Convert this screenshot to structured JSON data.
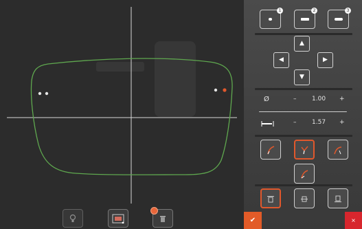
{
  "shape_tools": [
    {
      "name": "round-drill",
      "badge": "1"
    },
    {
      "name": "slot-drill",
      "badge": "2"
    },
    {
      "name": "notch-drill",
      "badge": "3"
    }
  ],
  "nudge": {
    "up": "▲",
    "left": "◀",
    "right": "▶",
    "down": "▼"
  },
  "diameter": {
    "symbol": "Ø",
    "minus": "–",
    "value": "1.00",
    "plus": "+"
  },
  "length": {
    "minus": "–",
    "value": "1.57",
    "plus": "+"
  },
  "ok_label": "✔",
  "close_label": "×",
  "colors": {
    "accent": "#e1582c",
    "lens_outline": "#5fa84f",
    "crosshair": "#d8d8d8",
    "danger": "#d7262d"
  },
  "icons": [
    "lightbulb-icon",
    "drill-pattern-icon",
    "trash-icon",
    "arrow-up-icon",
    "arrow-left-icon",
    "arrow-right-icon",
    "arrow-down-icon",
    "diameter-icon",
    "length-icon",
    "angle-icon",
    "align-icon",
    "check-icon",
    "close-icon"
  ]
}
